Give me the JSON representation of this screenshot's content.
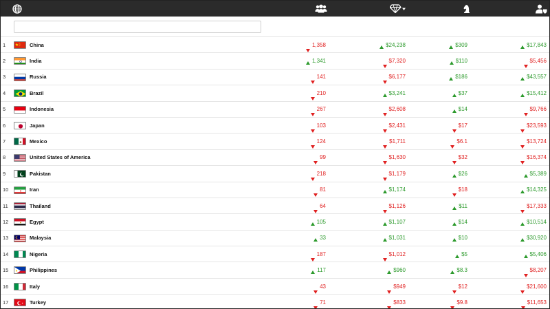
{
  "header": {
    "icons": [
      "globe-icon",
      "population-icon",
      "gem-dropdown-icon",
      "chess-knight-icon",
      "user-shield-icon"
    ]
  },
  "search": {
    "value": "",
    "placeholder": ""
  },
  "colors": {
    "header_bg": "#2b2b2b",
    "up": "#2c9a2c",
    "down": "#e02020"
  },
  "rows": [
    {
      "rank": "1",
      "country": "China",
      "flag": "china",
      "v1": {
        "text": "1,358",
        "dir": "down"
      },
      "v2": {
        "text": "$24,238",
        "dir": "up"
      },
      "v3": {
        "text": "$309",
        "dir": "up"
      },
      "v4": {
        "text": "$17,843",
        "dir": "up"
      }
    },
    {
      "rank": "2",
      "country": "India",
      "flag": "india",
      "v1": {
        "text": "1,341",
        "dir": "up"
      },
      "v2": {
        "text": "$7,320",
        "dir": "down"
      },
      "v3": {
        "text": "$110",
        "dir": "up"
      },
      "v4": {
        "text": "$5,456",
        "dir": "down"
      }
    },
    {
      "rank": "3",
      "country": "Russia",
      "flag": "russia",
      "v1": {
        "text": "141",
        "dir": "down"
      },
      "v2": {
        "text": "$6,177",
        "dir": "down"
      },
      "v3": {
        "text": "$186",
        "dir": "up"
      },
      "v4": {
        "text": "$43,557",
        "dir": "up"
      }
    },
    {
      "rank": "4",
      "country": "Brazil",
      "flag": "brazil",
      "v1": {
        "text": "210",
        "dir": "down"
      },
      "v2": {
        "text": "$3,241",
        "dir": "up"
      },
      "v3": {
        "text": "$37",
        "dir": "up"
      },
      "v4": {
        "text": "$15,412",
        "dir": "up"
      }
    },
    {
      "rank": "5",
      "country": "Indonesia",
      "flag": "indonesia",
      "v1": {
        "text": "267",
        "dir": "down"
      },
      "v2": {
        "text": "$2,608",
        "dir": "down"
      },
      "v3": {
        "text": "$14",
        "dir": "up"
      },
      "v4": {
        "text": "$9,766",
        "dir": "down"
      }
    },
    {
      "rank": "6",
      "country": "Japan",
      "flag": "japan",
      "v1": {
        "text": "103",
        "dir": "down"
      },
      "v2": {
        "text": "$2,431",
        "dir": "down"
      },
      "v3": {
        "text": "$17",
        "dir": "down"
      },
      "v4": {
        "text": "$23,593",
        "dir": "down"
      }
    },
    {
      "rank": "7",
      "country": "Mexico",
      "flag": "mexico",
      "v1": {
        "text": "124",
        "dir": "down"
      },
      "v2": {
        "text": "$1,711",
        "dir": "down"
      },
      "v3": {
        "text": "$6.1",
        "dir": "down"
      },
      "v4": {
        "text": "$13,724",
        "dir": "down"
      }
    },
    {
      "rank": "8",
      "country": "United States of America",
      "flag": "usa",
      "v1": {
        "text": "99",
        "dir": "down"
      },
      "v2": {
        "text": "$1,630",
        "dir": "down"
      },
      "v3": {
        "text": "$32",
        "dir": "down"
      },
      "v4": {
        "text": "$16,374",
        "dir": "down"
      }
    },
    {
      "rank": "9",
      "country": "Pakistan",
      "flag": "pakistan",
      "v1": {
        "text": "218",
        "dir": "down"
      },
      "v2": {
        "text": "$1,179",
        "dir": "down"
      },
      "v3": {
        "text": "$26",
        "dir": "up"
      },
      "v4": {
        "text": "$5,389",
        "dir": "up"
      }
    },
    {
      "rank": "10",
      "country": "Iran",
      "flag": "iran",
      "v1": {
        "text": "81",
        "dir": "down"
      },
      "v2": {
        "text": "$1,174",
        "dir": "up"
      },
      "v3": {
        "text": "$18",
        "dir": "down"
      },
      "v4": {
        "text": "$14,325",
        "dir": "up"
      }
    },
    {
      "rank": "11",
      "country": "Thailand",
      "flag": "thailand",
      "v1": {
        "text": "64",
        "dir": "down"
      },
      "v2": {
        "text": "$1,126",
        "dir": "down"
      },
      "v3": {
        "text": "$11",
        "dir": "up"
      },
      "v4": {
        "text": "$17,333",
        "dir": "down"
      }
    },
    {
      "rank": "12",
      "country": "Egypt",
      "flag": "egypt",
      "v1": {
        "text": "105",
        "dir": "up"
      },
      "v2": {
        "text": "$1,107",
        "dir": "up"
      },
      "v3": {
        "text": "$14",
        "dir": "up"
      },
      "v4": {
        "text": "$10,514",
        "dir": "up"
      }
    },
    {
      "rank": "13",
      "country": "Malaysia",
      "flag": "malaysia",
      "v1": {
        "text": "33",
        "dir": "up"
      },
      "v2": {
        "text": "$1,031",
        "dir": "up"
      },
      "v3": {
        "text": "$10",
        "dir": "up"
      },
      "v4": {
        "text": "$30,920",
        "dir": "up"
      }
    },
    {
      "rank": "14",
      "country": "Nigeria",
      "flag": "nigeria",
      "v1": {
        "text": "187",
        "dir": "down"
      },
      "v2": {
        "text": "$1,012",
        "dir": "down"
      },
      "v3": {
        "text": "$5",
        "dir": "up"
      },
      "v4": {
        "text": "$5,406",
        "dir": "up"
      }
    },
    {
      "rank": "15",
      "country": "Philippines",
      "flag": "philippines",
      "v1": {
        "text": "117",
        "dir": "up"
      },
      "v2": {
        "text": "$960",
        "dir": "up"
      },
      "v3": {
        "text": "$8.3",
        "dir": "up"
      },
      "v4": {
        "text": "$8,207",
        "dir": "down"
      }
    },
    {
      "rank": "16",
      "country": "Italy",
      "flag": "italy",
      "v1": {
        "text": "43",
        "dir": "down"
      },
      "v2": {
        "text": "$949",
        "dir": "down"
      },
      "v3": {
        "text": "$12",
        "dir": "down"
      },
      "v4": {
        "text": "$21,600",
        "dir": "down"
      }
    },
    {
      "rank": "17",
      "country": "Turkey",
      "flag": "turkey",
      "v1": {
        "text": "71",
        "dir": "down"
      },
      "v2": {
        "text": "$833",
        "dir": "down"
      },
      "v3": {
        "text": "$9.8",
        "dir": "down"
      },
      "v4": {
        "text": "$11,653",
        "dir": "down"
      }
    }
  ]
}
